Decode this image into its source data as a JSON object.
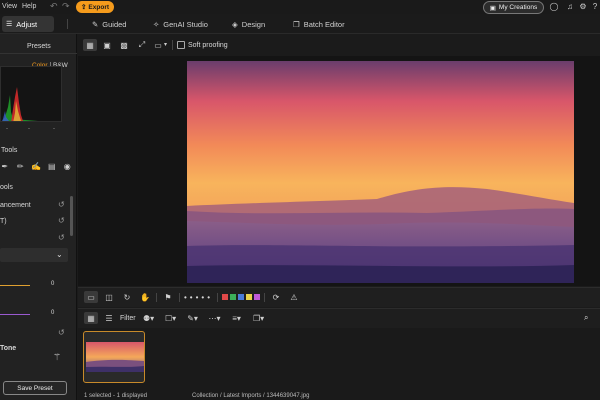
{
  "menu": {
    "items": [
      "View",
      "Help"
    ],
    "export_label": "Export",
    "my_creations_label": "My Creations"
  },
  "tabs": [
    {
      "label": "Adjust",
      "icon": "sliders-icon"
    },
    {
      "label": "Guided",
      "icon": "wand-icon"
    },
    {
      "label": "GenAI Studio",
      "icon": "sparkle-icon"
    },
    {
      "label": "Design",
      "icon": "palette-icon"
    },
    {
      "label": "Batch Editor",
      "icon": "layers-icon"
    }
  ],
  "left_panel": {
    "presets_label": "Presets",
    "color_label": "Color",
    "bw_label": "B&W",
    "tools_label": "Tools",
    "tools2_label": "ools",
    "enhancement_label": "ancement",
    "t_label": "T)",
    "slider1_value": "0",
    "slider2_value": "0",
    "tone_label": "Tone",
    "save_preset_label": "Save Preset"
  },
  "subtoolbar": {
    "soft_proofing_label": "Soft proofing"
  },
  "filter_bar": {
    "filter_label": "Filter"
  },
  "colors": {
    "accent": "#f59b1c",
    "labels": [
      "#e04848",
      "#3cae5a",
      "#4a7bd8",
      "#e9d34a",
      "#c05ad8"
    ]
  },
  "status": {
    "selection": "1 selected - 1 displayed",
    "path": "Collection / Latest Imports / 1344639047.jpg"
  }
}
